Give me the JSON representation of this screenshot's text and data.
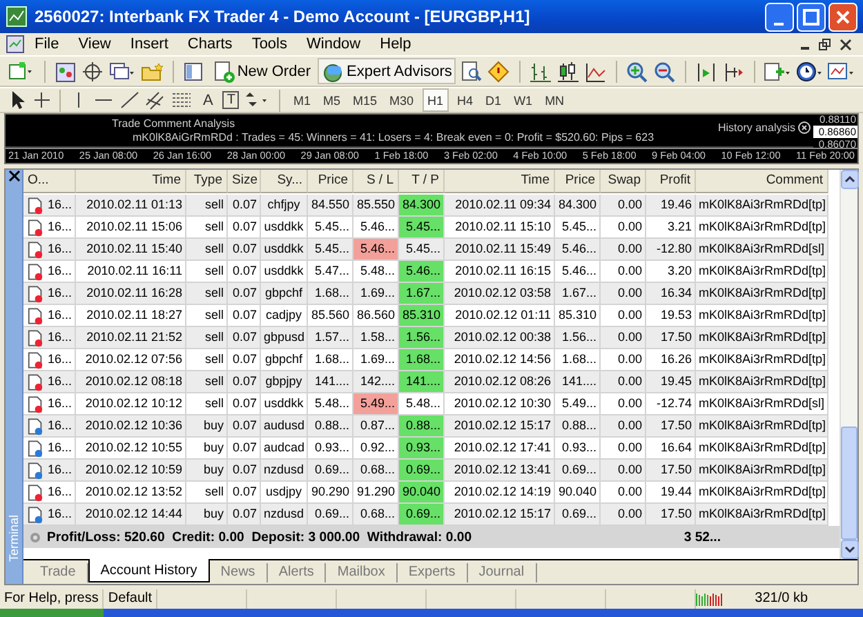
{
  "window": {
    "title": "2560027: Interbank FX Trader 4 - Demo Account - [EURGBP,H1]"
  },
  "menu": [
    "File",
    "View",
    "Insert",
    "Charts",
    "Tools",
    "Window",
    "Help"
  ],
  "toolbar": {
    "buttons": [
      {
        "label": "New Order"
      },
      {
        "label": "Expert Advisors"
      }
    ]
  },
  "drawing_toolbar": {
    "text_tools": [
      "A",
      "T"
    ],
    "timeframes": [
      {
        "label": "M1",
        "selected": false
      },
      {
        "label": "M5",
        "selected": false
      },
      {
        "label": "M15",
        "selected": false
      },
      {
        "label": "M30",
        "selected": false
      },
      {
        "label": "H1",
        "selected": true
      },
      {
        "label": "H4",
        "selected": false
      },
      {
        "label": "D1",
        "selected": false
      },
      {
        "label": "W1",
        "selected": false
      },
      {
        "label": "MN",
        "selected": false
      }
    ]
  },
  "chart": {
    "heading": "Trade Comment Analysis",
    "summary": "mK0lK8AiGrRmRDd : Trades = 45: Winners = 41: Losers = 4: Break even = 0: Profit = $520.60: Pips = 623",
    "indicator_label": "History analysis",
    "price_labels": [
      {
        "text": "0.88110",
        "selected": false
      },
      {
        "text": "0.86860",
        "selected": true
      },
      {
        "text": "0.86070",
        "selected": false
      }
    ],
    "time_labels": [
      "21 Jan 2010",
      "25 Jan 08:00",
      "26 Jan 16:00",
      "28 Jan 00:00",
      "29 Jan 08:00",
      "1 Feb 18:00",
      "3 Feb 02:00",
      "4 Feb 10:00",
      "5 Feb 18:00",
      "9 Feb 04:00",
      "10 Feb 12:00",
      "11 Feb 20:00"
    ]
  },
  "terminal": {
    "label": "Terminal",
    "columns": [
      "O...",
      "Time",
      "Type",
      "Size",
      "Sy...",
      "Price",
      "S / L",
      "T / P",
      "Time",
      "Price",
      "Swap",
      "Profit",
      "Comment"
    ],
    "rows": [
      {
        "order": "16...",
        "time": "2010.02.11 01:13",
        "type": "sell",
        "size": "0.07",
        "symbol": "chfjpy",
        "price": "84.550",
        "sl": "85.550",
        "tp": "84.300",
        "close_time": "2010.02.11 09:34",
        "close_price": "84.300",
        "swap": "0.00",
        "profit": "19.46",
        "comment": "mK0lK8Ai3rRmRDd[tp]",
        "tp_hit": true,
        "sl_hit": false
      },
      {
        "order": "16...",
        "time": "2010.02.11 15:06",
        "type": "sell",
        "size": "0.07",
        "symbol": "usddkk",
        "price": "5.45...",
        "sl": "5.46...",
        "tp": "5.45...",
        "close_time": "2010.02.11 15:10",
        "close_price": "5.45...",
        "swap": "0.00",
        "profit": "3.21",
        "comment": "mK0lK8Ai3rRmRDd[tp]",
        "tp_hit": true,
        "sl_hit": false
      },
      {
        "order": "16...",
        "time": "2010.02.11 15:40",
        "type": "sell",
        "size": "0.07",
        "symbol": "usddkk",
        "price": "5.45...",
        "sl": "5.46...",
        "tp": "5.45...",
        "close_time": "2010.02.11 15:49",
        "close_price": "5.46...",
        "swap": "0.00",
        "profit": "-12.80",
        "comment": "mK0lK8Ai3rRmRDd[sl]",
        "tp_hit": false,
        "sl_hit": true
      },
      {
        "order": "16...",
        "time": "2010.02.11 16:11",
        "type": "sell",
        "size": "0.07",
        "symbol": "usddkk",
        "price": "5.47...",
        "sl": "5.48...",
        "tp": "5.46...",
        "close_time": "2010.02.11 16:15",
        "close_price": "5.46...",
        "swap": "0.00",
        "profit": "3.20",
        "comment": "mK0lK8Ai3rRmRDd[tp]",
        "tp_hit": true,
        "sl_hit": false
      },
      {
        "order": "16...",
        "time": "2010.02.11 16:28",
        "type": "sell",
        "size": "0.07",
        "symbol": "gbpchf",
        "price": "1.68...",
        "sl": "1.69...",
        "tp": "1.67...",
        "close_time": "2010.02.12 03:58",
        "close_price": "1.67...",
        "swap": "0.00",
        "profit": "16.34",
        "comment": "mK0lK8Ai3rRmRDd[tp]",
        "tp_hit": true,
        "sl_hit": false
      },
      {
        "order": "16...",
        "time": "2010.02.11 18:27",
        "type": "sell",
        "size": "0.07",
        "symbol": "cadjpy",
        "price": "85.560",
        "sl": "86.560",
        "tp": "85.310",
        "close_time": "2010.02.12 01:11",
        "close_price": "85.310",
        "swap": "0.00",
        "profit": "19.53",
        "comment": "mK0lK8Ai3rRmRDd[tp]",
        "tp_hit": true,
        "sl_hit": false
      },
      {
        "order": "16...",
        "time": "2010.02.11 21:52",
        "type": "sell",
        "size": "0.07",
        "symbol": "gbpusd",
        "price": "1.57...",
        "sl": "1.58...",
        "tp": "1.56...",
        "close_time": "2010.02.12 00:38",
        "close_price": "1.56...",
        "swap": "0.00",
        "profit": "17.50",
        "comment": "mK0lK8Ai3rRmRDd[tp]",
        "tp_hit": true,
        "sl_hit": false
      },
      {
        "order": "16...",
        "time": "2010.02.12 07:56",
        "type": "sell",
        "size": "0.07",
        "symbol": "gbpchf",
        "price": "1.68...",
        "sl": "1.69...",
        "tp": "1.68...",
        "close_time": "2010.02.12 14:56",
        "close_price": "1.68...",
        "swap": "0.00",
        "profit": "16.26",
        "comment": "mK0lK8Ai3rRmRDd[tp]",
        "tp_hit": true,
        "sl_hit": false
      },
      {
        "order": "16...",
        "time": "2010.02.12 08:18",
        "type": "sell",
        "size": "0.07",
        "symbol": "gbpjpy",
        "price": "141....",
        "sl": "142....",
        "tp": "141....",
        "close_time": "2010.02.12 08:26",
        "close_price": "141....",
        "swap": "0.00",
        "profit": "19.45",
        "comment": "mK0lK8Ai3rRmRDd[tp]",
        "tp_hit": true,
        "sl_hit": false
      },
      {
        "order": "16...",
        "time": "2010.02.12 10:12",
        "type": "sell",
        "size": "0.07",
        "symbol": "usddkk",
        "price": "5.48...",
        "sl": "5.49...",
        "tp": "5.48...",
        "close_time": "2010.02.12 10:30",
        "close_price": "5.49...",
        "swap": "0.00",
        "profit": "-12.74",
        "comment": "mK0lK8Ai3rRmRDd[sl]",
        "tp_hit": false,
        "sl_hit": true
      },
      {
        "order": "16...",
        "time": "2010.02.12 10:36",
        "type": "buy",
        "size": "0.07",
        "symbol": "audusd",
        "price": "0.88...",
        "sl": "0.87...",
        "tp": "0.88...",
        "close_time": "2010.02.12 15:17",
        "close_price": "0.88...",
        "swap": "0.00",
        "profit": "17.50",
        "comment": "mK0lK8Ai3rRmRDd[tp]",
        "tp_hit": true,
        "sl_hit": false
      },
      {
        "order": "16...",
        "time": "2010.02.12 10:55",
        "type": "buy",
        "size": "0.07",
        "symbol": "audcad",
        "price": "0.93...",
        "sl": "0.92...",
        "tp": "0.93...",
        "close_time": "2010.02.12 17:41",
        "close_price": "0.93...",
        "swap": "0.00",
        "profit": "16.64",
        "comment": "mK0lK8Ai3rRmRDd[tp]",
        "tp_hit": true,
        "sl_hit": false
      },
      {
        "order": "16...",
        "time": "2010.02.12 10:59",
        "type": "buy",
        "size": "0.07",
        "symbol": "nzdusd",
        "price": "0.69...",
        "sl": "0.68...",
        "tp": "0.69...",
        "close_time": "2010.02.12 13:41",
        "close_price": "0.69...",
        "swap": "0.00",
        "profit": "17.50",
        "comment": "mK0lK8Ai3rRmRDd[tp]",
        "tp_hit": true,
        "sl_hit": false
      },
      {
        "order": "16...",
        "time": "2010.02.12 13:52",
        "type": "sell",
        "size": "0.07",
        "symbol": "usdjpy",
        "price": "90.290",
        "sl": "91.290",
        "tp": "90.040",
        "close_time": "2010.02.12 14:19",
        "close_price": "90.040",
        "swap": "0.00",
        "profit": "19.44",
        "comment": "mK0lK8Ai3rRmRDd[tp]",
        "tp_hit": true,
        "sl_hit": false
      },
      {
        "order": "16...",
        "time": "2010.02.12 14:44",
        "type": "buy",
        "size": "0.07",
        "symbol": "nzdusd",
        "price": "0.69...",
        "sl": "0.68...",
        "tp": "0.69...",
        "close_time": "2010.02.12 15:17",
        "close_price": "0.69...",
        "swap": "0.00",
        "profit": "17.50",
        "comment": "mK0lK8Ai3rRmRDd[tp]",
        "tp_hit": true,
        "sl_hit": false
      }
    ],
    "summary": {
      "text": "Profit/Loss: 520.60  Credit: 0.00  Deposit: 3 000.00  Withdrawal: 0.00",
      "total": "3 52..."
    },
    "tabs": [
      {
        "label": "Trade",
        "selected": false
      },
      {
        "label": "Account History",
        "selected": true
      },
      {
        "label": "News",
        "selected": false
      },
      {
        "label": "Alerts",
        "selected": false
      },
      {
        "label": "Mailbox",
        "selected": false
      },
      {
        "label": "Experts",
        "selected": false
      },
      {
        "label": "Journal",
        "selected": false
      }
    ]
  },
  "status_bar": {
    "help": "For Help, press",
    "profile": "Default",
    "traffic": "321/0 kb"
  }
}
